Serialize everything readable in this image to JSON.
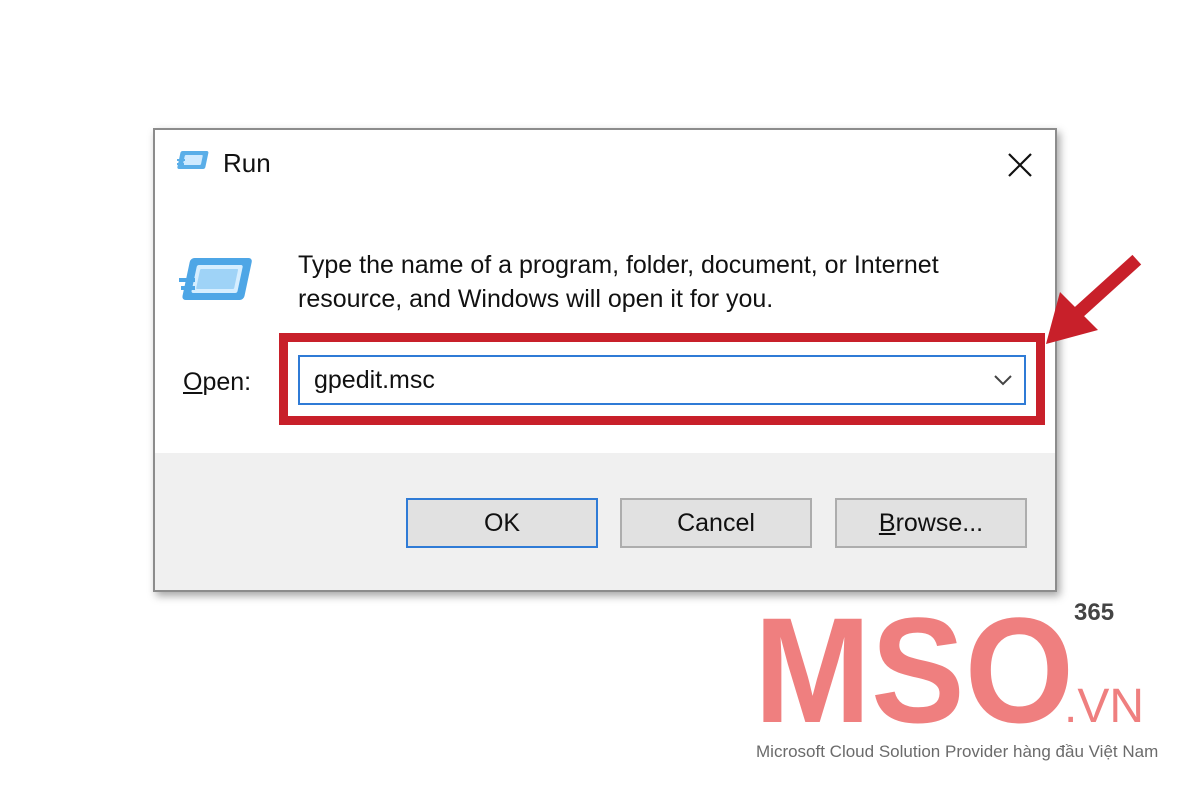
{
  "window": {
    "title": "Run",
    "title_icon": "run-icon",
    "close_icon": "close-icon"
  },
  "body": {
    "description": "Type the name of a program, folder, document, or Internet resource, and Windows will open it for you.",
    "open_label_first": "O",
    "open_label_rest": "pen:",
    "open_value": "gpedit.msc"
  },
  "buttons": {
    "ok": "OK",
    "cancel": "Cancel",
    "browse_first": "B",
    "browse_rest": "rowse..."
  },
  "annotation": {
    "highlight_color": "#c8202a",
    "arrow_icon": "red-arrow-icon"
  },
  "watermark": {
    "logo_text": "MSO",
    "superscript": "365",
    "suffix": ".VN",
    "tagline": "Microsoft Cloud Solution Provider hàng đầu Việt Nam",
    "logo_color": "#ef7f7f"
  }
}
